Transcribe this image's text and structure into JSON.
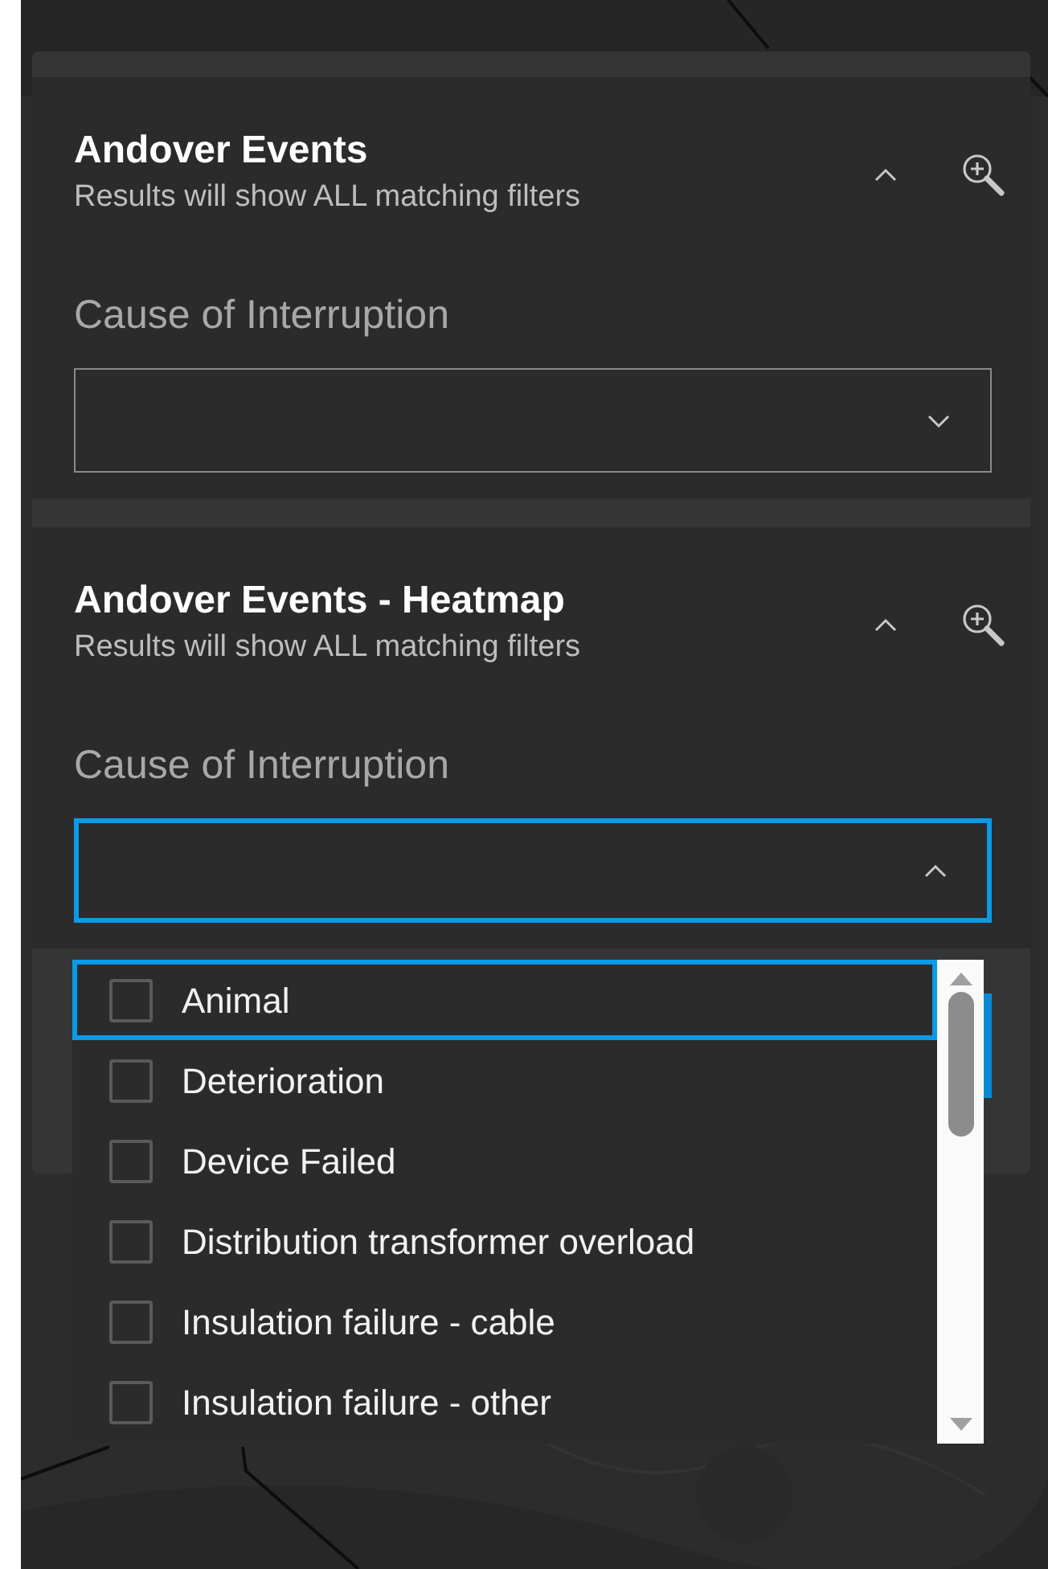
{
  "sections": [
    {
      "title": "Andover Events",
      "subtitle": "Results will show ALL matching filters",
      "expanded": true,
      "filter": {
        "label": "Cause of Interruption",
        "open": false
      }
    },
    {
      "title": "Andover Events - Heatmap",
      "subtitle": "Results will show ALL matching filters",
      "expanded": true,
      "filter": {
        "label": "Cause of Interruption",
        "open": true
      }
    }
  ],
  "dropdown": {
    "options": [
      {
        "label": "Animal",
        "checked": false,
        "focused": true
      },
      {
        "label": "Deterioration",
        "checked": false,
        "focused": false
      },
      {
        "label": "Device Failed",
        "checked": false,
        "focused": false
      },
      {
        "label": "Distribution transformer overload",
        "checked": false,
        "focused": false
      },
      {
        "label": "Insulation failure - cable",
        "checked": false,
        "focused": false
      },
      {
        "label": "Insulation failure - other",
        "checked": false,
        "focused": false
      }
    ]
  }
}
